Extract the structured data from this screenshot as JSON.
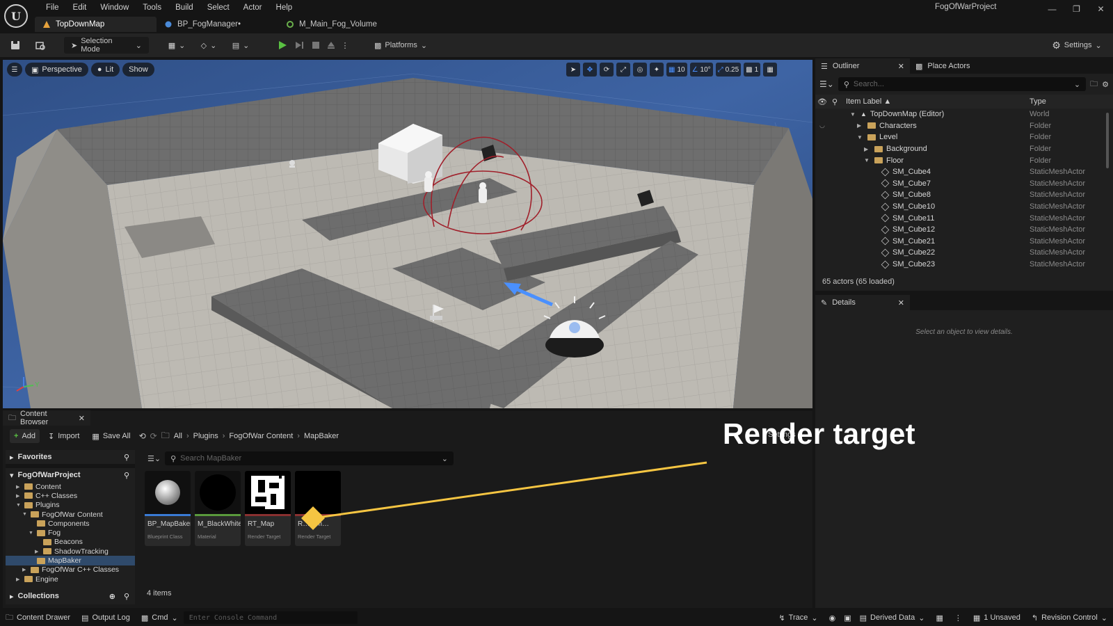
{
  "app": {
    "logo": "U",
    "project_name": "FogOfWarProject",
    "menu": [
      "File",
      "Edit",
      "Window",
      "Tools",
      "Build",
      "Select",
      "Actor",
      "Help"
    ],
    "window_controls": [
      "minimize-icon",
      "restore-icon",
      "close-icon"
    ]
  },
  "doc_tabs": [
    {
      "label": "TopDownMap",
      "icon": "level-icon",
      "color": "#e6a23c",
      "active": true
    },
    {
      "label": "BP_FogManager•",
      "icon": "blueprint-icon",
      "color": "#4a8ad8",
      "active": false
    },
    {
      "label": "M_Main_Fog_Volume",
      "icon": "material-icon",
      "color": "#6ab04c",
      "active": false
    }
  ],
  "toolbar": {
    "selection_mode": "Selection Mode",
    "platforms": "Platforms",
    "settings": "Settings",
    "play_color": "#5ac142"
  },
  "viewport": {
    "perspective": "Perspective",
    "lit": "Lit",
    "show": "Show",
    "grid_snap": "10",
    "rotation_snap": "10°",
    "scale_snap": "0.25",
    "camera_speed": "1",
    "axis_y": "Y"
  },
  "outliner": {
    "tab_label": "Outliner",
    "place_actors": "Place Actors",
    "search_placeholder": "Search...",
    "col_label": "Item Label ▲",
    "col_type": "Type",
    "rows": [
      {
        "label": "TopDownMap (Editor)",
        "type": "World",
        "indent": 0,
        "kind": "world",
        "arrow": "▼"
      },
      {
        "label": "Characters",
        "type": "Folder",
        "indent": 1,
        "kind": "folder",
        "arrow": "▶"
      },
      {
        "label": "Level",
        "type": "Folder",
        "indent": 1,
        "kind": "folder",
        "arrow": "▼"
      },
      {
        "label": "Background",
        "type": "Folder",
        "indent": 2,
        "kind": "folder",
        "arrow": "▶"
      },
      {
        "label": "Floor",
        "type": "Folder",
        "indent": 2,
        "kind": "folder",
        "arrow": "▼"
      },
      {
        "label": "SM_Cube4",
        "type": "StaticMeshActor",
        "indent": 3,
        "kind": "mesh",
        "arrow": ""
      },
      {
        "label": "SM_Cube7",
        "type": "StaticMeshActor",
        "indent": 3,
        "kind": "mesh",
        "arrow": ""
      },
      {
        "label": "SM_Cube8",
        "type": "StaticMeshActor",
        "indent": 3,
        "kind": "mesh",
        "arrow": ""
      },
      {
        "label": "SM_Cube10",
        "type": "StaticMeshActor",
        "indent": 3,
        "kind": "mesh",
        "arrow": ""
      },
      {
        "label": "SM_Cube11",
        "type": "StaticMeshActor",
        "indent": 3,
        "kind": "mesh",
        "arrow": ""
      },
      {
        "label": "SM_Cube12",
        "type": "StaticMeshActor",
        "indent": 3,
        "kind": "mesh",
        "arrow": ""
      },
      {
        "label": "SM_Cube21",
        "type": "StaticMeshActor",
        "indent": 3,
        "kind": "mesh",
        "arrow": ""
      },
      {
        "label": "SM_Cube22",
        "type": "StaticMeshActor",
        "indent": 3,
        "kind": "mesh",
        "arrow": ""
      },
      {
        "label": "SM_Cube23",
        "type": "StaticMeshActor",
        "indent": 3,
        "kind": "mesh",
        "arrow": ""
      }
    ],
    "status": "65 actors (65 loaded)"
  },
  "details": {
    "tab_label": "Details",
    "hint": "Select an object to view details."
  },
  "content_browser": {
    "tab_label": "Content Browser",
    "add": "Add",
    "import": "Import",
    "save_all": "Save All",
    "breadcrumb": [
      "All",
      "Plugins",
      "FogOfWar Content",
      "MapBaker"
    ],
    "search_placeholder": "Search MapBaker",
    "favorites": "Favorites",
    "project": "FogOfWarProject",
    "collections": "Collections",
    "folders": [
      {
        "label": "Content",
        "indent": 1,
        "arrow": "▶",
        "selected": false
      },
      {
        "label": "C++ Classes",
        "indent": 1,
        "arrow": "▶",
        "selected": false
      },
      {
        "label": "Plugins",
        "indent": 1,
        "arrow": "▼",
        "selected": false
      },
      {
        "label": "FogOfWar Content",
        "indent": 2,
        "arrow": "▼",
        "selected": false
      },
      {
        "label": "Components",
        "indent": 3,
        "arrow": "",
        "selected": false
      },
      {
        "label": "Fog",
        "indent": 3,
        "arrow": "▼",
        "selected": false
      },
      {
        "label": "Beacons",
        "indent": 4,
        "arrow": "",
        "selected": false
      },
      {
        "label": "ShadowTracking",
        "indent": 4,
        "arrow": "▶",
        "selected": false
      },
      {
        "label": "MapBaker",
        "indent": 3,
        "arrow": "",
        "selected": true
      },
      {
        "label": "FogOfWar C++ Classes",
        "indent": 2,
        "arrow": "▶",
        "selected": false
      },
      {
        "label": "Engine",
        "indent": 1,
        "arrow": "▶",
        "selected": false
      }
    ],
    "assets": [
      {
        "name": "BP_MapBaker",
        "type": "Blueprint Class",
        "stripe": "#3a7bd5"
      },
      {
        "name": "M_BlackWhite",
        "type": "Material",
        "stripe": "#5a9a3c"
      },
      {
        "name": "RT_Map",
        "type": "Render Target",
        "stripe": "#8a3030"
      },
      {
        "name": "R… Sm…",
        "type": "Render Target",
        "stripe": "#8a3030"
      }
    ],
    "item_count": "4 items",
    "settings_partial": "Settings"
  },
  "statusbar": {
    "content_drawer": "Content Drawer",
    "output_log": "Output Log",
    "cmd": "Cmd",
    "console_placeholder": "Enter Console Command",
    "trace": "Trace",
    "derived_data": "Derived Data",
    "unsaved": "1 Unsaved",
    "revision_control": "Revision Control"
  },
  "overlay": {
    "title": "Render target",
    "accent": "#f5c542"
  }
}
